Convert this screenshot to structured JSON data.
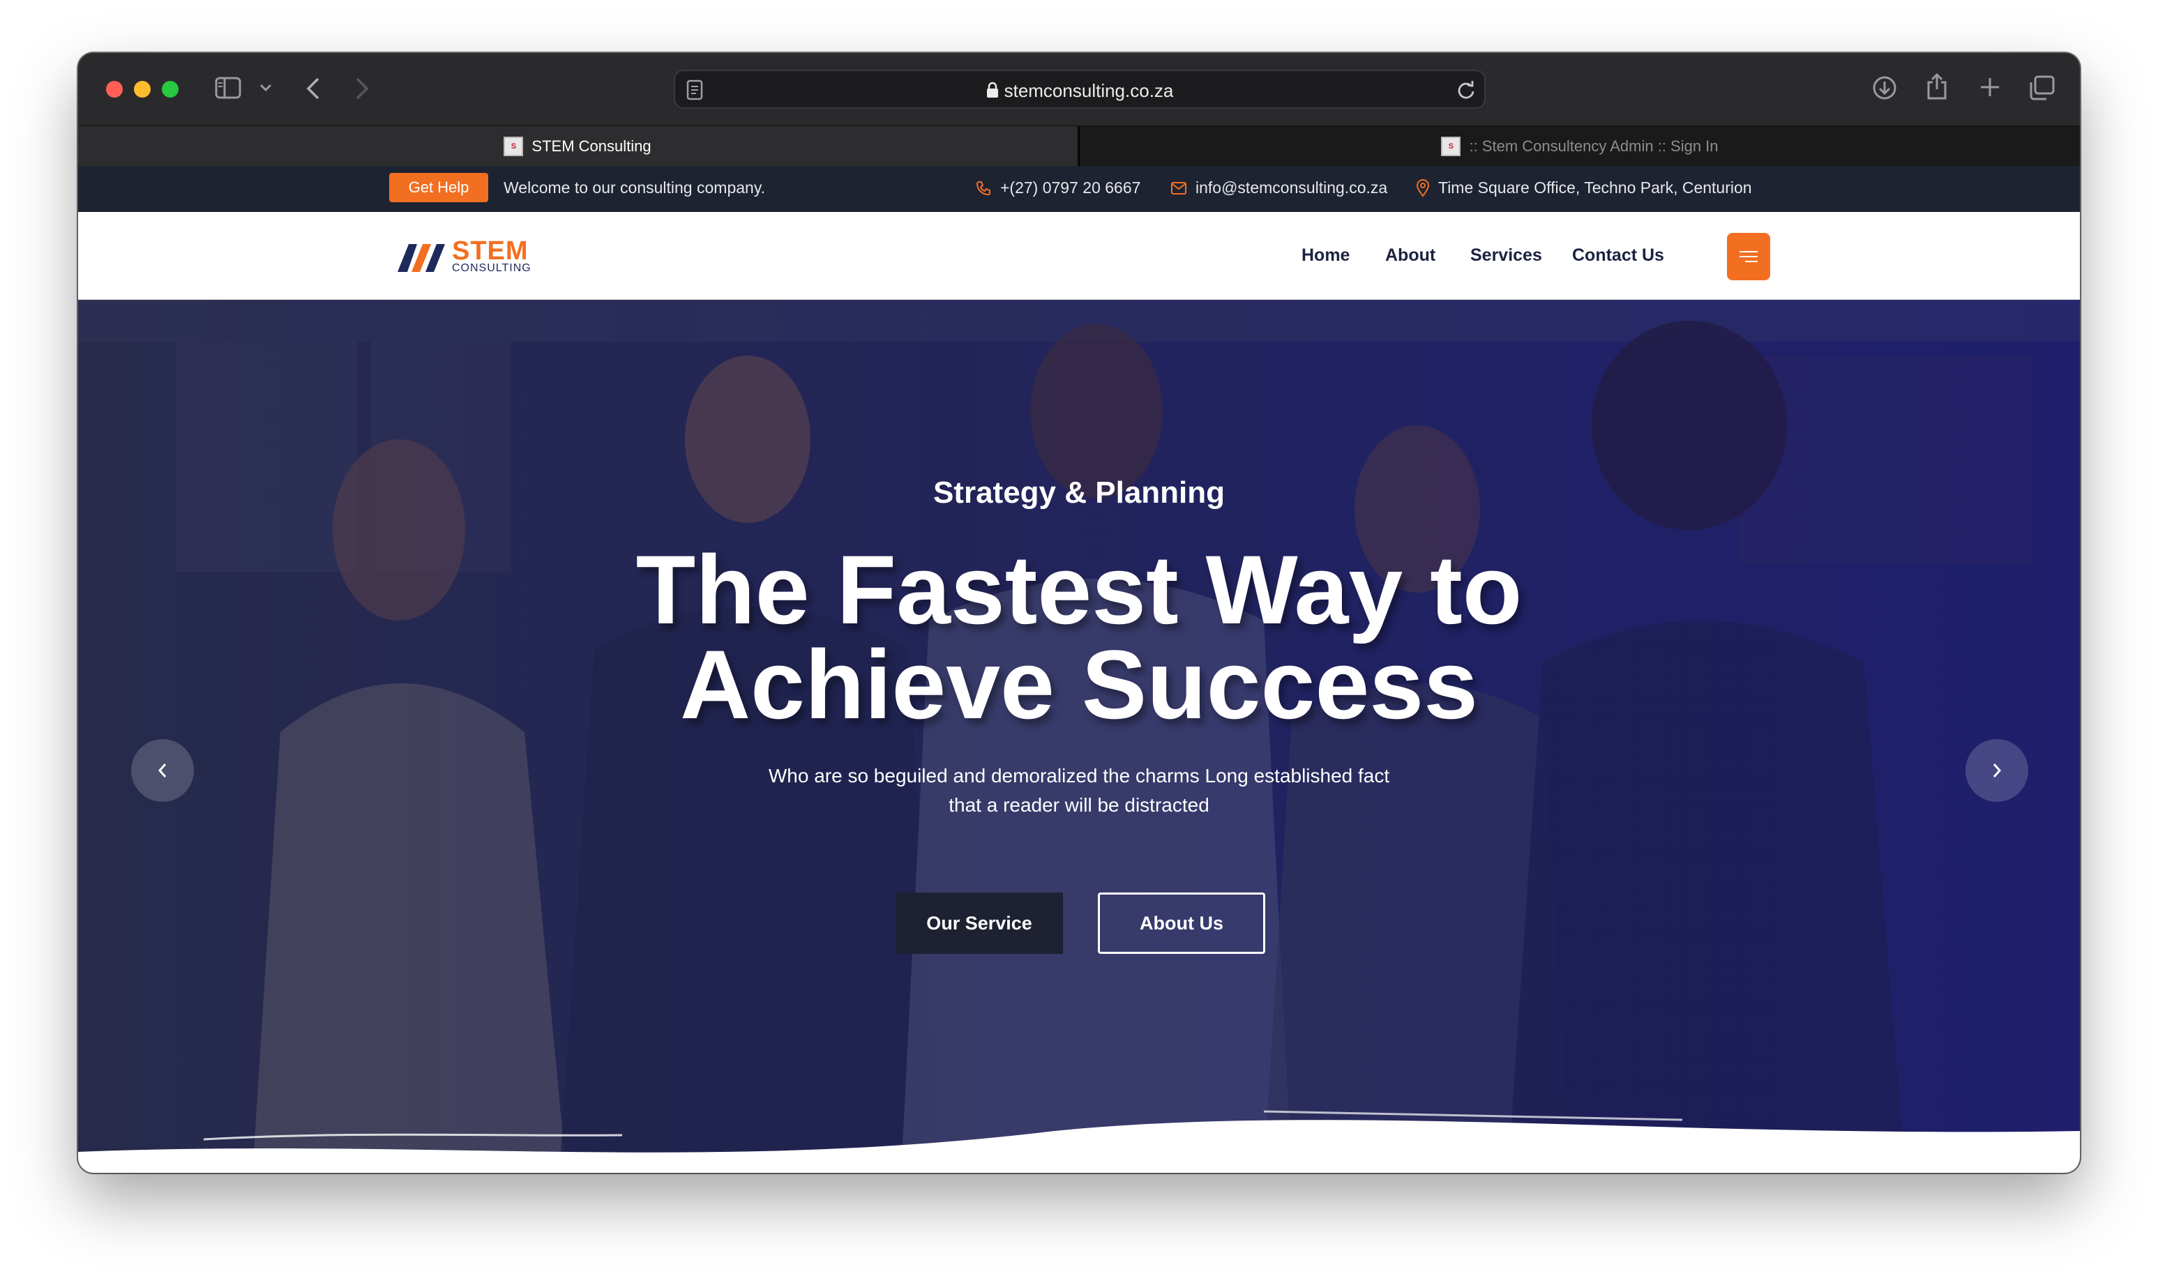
{
  "browser": {
    "url": "stemconsulting.co.za",
    "tabs": [
      {
        "label": "STEM Consulting"
      },
      {
        "label": ":: Stem Consultency Admin :: Sign In"
      }
    ]
  },
  "infobar": {
    "get_help": "Get Help",
    "welcome": "Welcome to our consulting company.",
    "phone": "+(27) 0797 20 6667",
    "email": "info@stemconsulting.co.za",
    "address": "Time Square Office, Techno Park, Centurion"
  },
  "logo": {
    "name": "STEM",
    "sub": "CONSULTING"
  },
  "nav": {
    "items": [
      {
        "label": "Home"
      },
      {
        "label": "About"
      },
      {
        "label": "Services"
      },
      {
        "label": "Contact Us"
      }
    ]
  },
  "hero": {
    "subtitle": "Strategy & Planning",
    "title_line1": "The Fastest Way to",
    "title_line2": "Achieve Success",
    "desc_line1": "Who are so beguiled and demoralized the charms Long established fact",
    "desc_line2": "that a reader will be distracted",
    "btn_service": "Our Service",
    "btn_about": "About Us"
  },
  "colors": {
    "accent": "#f26f21",
    "topbar": "#1e2331",
    "hero_overlay": "#222466",
    "nav_text": "#1c2240"
  },
  "icons": [
    "sidebar-icon",
    "chevron-down-icon",
    "back-icon",
    "forward-icon",
    "page-icon",
    "lock-icon",
    "reload-icon",
    "download-icon",
    "share-icon",
    "new-tab-icon",
    "tabs-overview-icon",
    "phone-icon",
    "mail-icon",
    "location-icon",
    "hamburger-icon",
    "arrow-left-icon",
    "arrow-right-icon"
  ]
}
